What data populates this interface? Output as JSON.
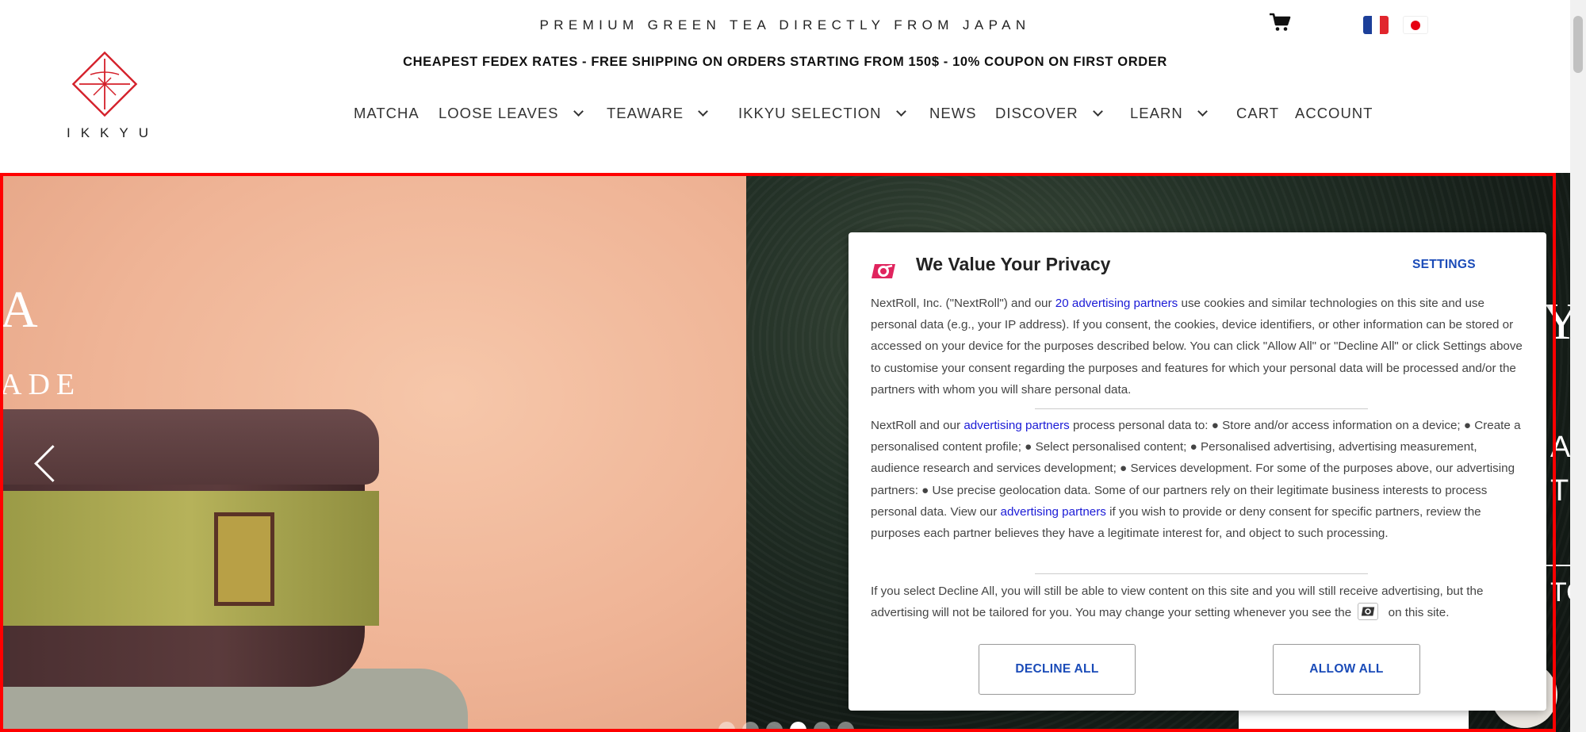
{
  "header": {
    "tagline": "PREMIUM GREEN TEA DIRECTLY FROM JAPAN",
    "shipping": "CHEAPEST FEDEX RATES - FREE SHIPPING ON ORDERS STARTING FROM 150$ - 10% COUPON ON FIRST ORDER",
    "logo_text": "IKKYU",
    "cart_icon": "shopping-cart-icon",
    "languages": [
      "fr",
      "jp"
    ]
  },
  "nav": {
    "items": [
      {
        "label": "MATCHA",
        "dropdown": false
      },
      {
        "label": "LOOSE LEAVES",
        "dropdown": true
      },
      {
        "label": "TEAWARE",
        "dropdown": true
      },
      {
        "label": "IKKYU SELECTION",
        "dropdown": true
      },
      {
        "label": "NEWS",
        "dropdown": false
      },
      {
        "label": "DISCOVER",
        "dropdown": true
      },
      {
        "label": "LEARN",
        "dropdown": true
      },
      {
        "label": "CART",
        "dropdown": false
      },
      {
        "label": "ACCOUNT",
        "dropdown": false
      }
    ]
  },
  "hero": {
    "left_title_fragment": "A",
    "left_subtitle_fragment": "ADE",
    "right_fragments": [
      "Y",
      "A",
      "T",
      "TO"
    ],
    "slides_total": 6,
    "active_slide": 4
  },
  "privacy": {
    "title": "We Value Your Privacy",
    "settings": "SETTINGS",
    "p1_a": "NextRoll, Inc. (\"NextRoll\") and our ",
    "p1_link": "20 advertising partners",
    "p1_b": " use cookies and similar technologies on this site and use personal data (e.g., your IP address). If you consent, the cookies, device identifiers, or other information can be stored or accessed on your device for the purposes described below. You can click \"Allow All\" or \"Decline All\" or click Settings above to customise your consent regarding the purposes and features for which your personal data will be processed and/or the partners with whom you will share personal data.",
    "p2_a": "NextRoll and our ",
    "p2_link1": "advertising partners",
    "p2_b": " process personal data to: ● Store and/or access information on a device; ● Create a personalised content profile; ● Select personalised content; ● Personalised advertising, advertising measurement, audience research and services development; ● Services development. For some of the purposes above, our advertising partners: ● Use precise geolocation data. Some of our partners rely on their legitimate business interests to process personal data. View our ",
    "p2_link2": "advertising partners",
    "p2_c": " if you wish to provide or deny consent for specific partners, review the purposes each partner believes they have a legitimate interest for, and object to such processing.",
    "p3_a": "If you select Decline All, you will still be able to view content on this site and you will still receive advertising, but the advertising will not be tailored for you. You may change your setting whenever you see the ",
    "p3_b": " on this site.",
    "decline": "DECLINE ALL",
    "allow": "ALLOW ALL"
  }
}
